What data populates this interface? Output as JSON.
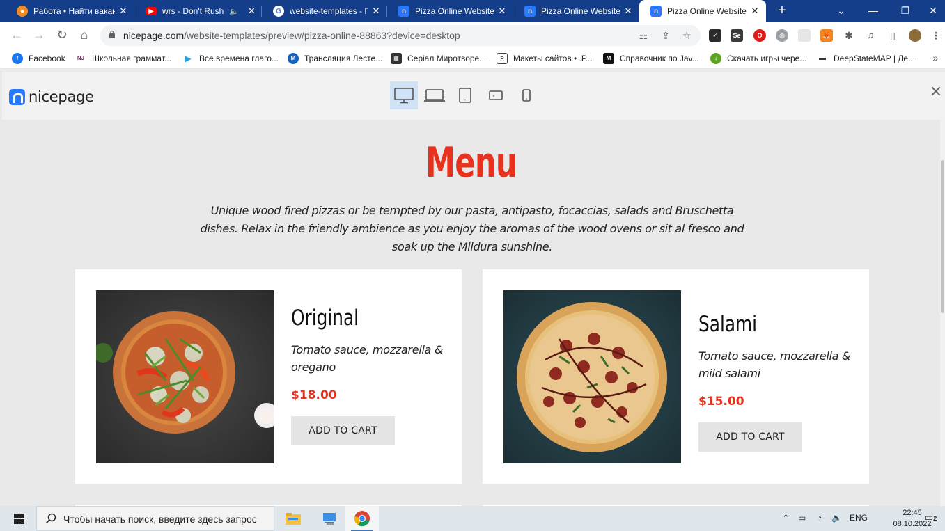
{
  "browser": {
    "tabs": [
      {
        "title": "Работа • Найти вакансию",
        "icon": "hh-icon",
        "active": false
      },
      {
        "title": "wrs - Don't Rush | Eurovision",
        "icon": "youtube-icon",
        "active": false
      },
      {
        "title": "website-templates - Поиск в Google",
        "icon": "google-icon",
        "active": false
      },
      {
        "title": "Pizza Online Website Template",
        "icon": "nicepage-icon",
        "active": false
      },
      {
        "title": "Pizza Online Website Template",
        "icon": "nicepage-icon",
        "active": false
      },
      {
        "title": "Pizza Online Website Template",
        "icon": "nicepage-icon",
        "active": true
      }
    ],
    "url_host": "nicepage.com",
    "url_path": "/website-templates/preview/pizza-online-88863?device=desktop",
    "bookmarks": [
      {
        "label": "Facebook",
        "icon": "facebook-icon",
        "color": "#1877f2"
      },
      {
        "label": "Школьная граммат...",
        "icon": "njnj-icon",
        "color": "#8e1f6c"
      },
      {
        "label": "Все времена глаго...",
        "icon": "play-icon",
        "color": "#1aa3e8"
      },
      {
        "label": "Трансляция Лесте...",
        "icon": "m-icon",
        "color": "#1565c0"
      },
      {
        "label": "Серіал Миротворе...",
        "icon": "film-icon",
        "color": "#333333"
      },
      {
        "label": "Макеты сайтов • .Р...",
        "icon": "psd-icon",
        "color": "#444444"
      },
      {
        "label": "Справочник по Jav...",
        "icon": "m-black-icon",
        "color": "#111111"
      },
      {
        "label": "Скачать игры чере...",
        "icon": "torrent-icon",
        "color": "#5da423"
      },
      {
        "label": "DeepStateMAP | Де...",
        "icon": "map-icon",
        "color": "#333333"
      }
    ]
  },
  "preview": {
    "logo_text": "nicepage",
    "devices": [
      "desktop",
      "laptop",
      "tablet",
      "tablet-landscape",
      "phone"
    ],
    "active_device": "desktop"
  },
  "page": {
    "title": "Menu",
    "description": "Unique wood fired pizzas or be tempted by our pasta, antipasto, focaccias, salads and Bruschetta dishes. Relax in the friendly ambience as you enjoy the aromas of the wood ovens or sit al fresco and soak up the Mildura sunshine.",
    "items": [
      {
        "name": "Original",
        "description": "Tomato sauce, mozzarella & oregano",
        "price": "$18.00",
        "button": "ADD TO CART"
      },
      {
        "name": "Salami",
        "description": "Tomato sauce, mozzarella & mild salami",
        "price": "$15.00",
        "button": "ADD TO CART"
      }
    ]
  },
  "taskbar": {
    "search_placeholder": "Чтобы начать поиск, введите здесь запрос",
    "language": "ENG",
    "time": "22:45",
    "date": "08.10.2022",
    "notifications": "2"
  },
  "colors": {
    "accent": "#e8321d",
    "tabstrip": "#143d8a",
    "nicepage_blue": "#2979ff"
  }
}
